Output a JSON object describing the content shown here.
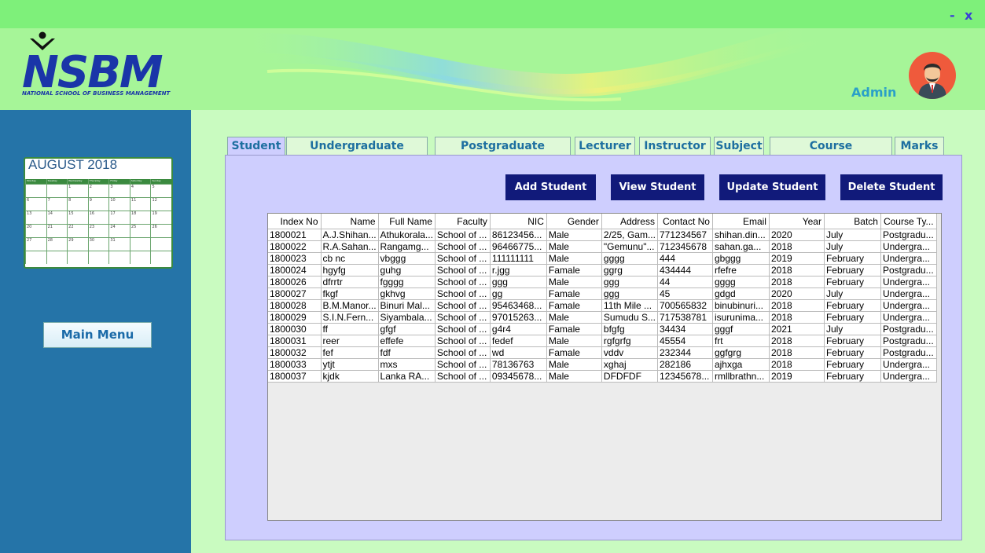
{
  "window": {
    "minimize": "-",
    "close": "x"
  },
  "logo": {
    "text": "NSBM",
    "subtitle": "NATIONAL SCHOOL OF BUSINESS MANAGEMENT"
  },
  "header": {
    "user": "Admin"
  },
  "calendar": {
    "title": "AUGUST 2018",
    "days": [
      "Monday",
      "Tuesday",
      "Wednesday",
      "Thursday",
      "Friday",
      "Saturday",
      "Sunday"
    ],
    "rows": [
      [
        "",
        "",
        "1",
        "2",
        "3",
        "4",
        "5"
      ],
      [
        "6",
        "7",
        "8",
        "9",
        "10",
        "11",
        "12"
      ],
      [
        "13",
        "14",
        "15",
        "16",
        "17",
        "18",
        "19"
      ],
      [
        "20",
        "21",
        "22",
        "23",
        "24",
        "25",
        "26"
      ],
      [
        "27",
        "28",
        "29",
        "30",
        "31",
        "",
        ""
      ],
      [
        "",
        "",
        "",
        "",
        "",
        "",
        ""
      ]
    ]
  },
  "sidebar": {
    "main_menu": "Main Menu"
  },
  "tabs": [
    "Student",
    "Undergraduate Student",
    "Postgraduate Student",
    "Lecturer",
    "Instructor",
    "Subject",
    "Course Registration",
    "Marks"
  ],
  "buttons": {
    "add": "Add Student",
    "view": "View Student",
    "update": "Update Student",
    "delete": "Delete Student"
  },
  "table": {
    "columns": [
      "Index No",
      "Name",
      "Full Name",
      "Faculty",
      "NIC",
      "Gender",
      "Address",
      "Contact No",
      "Email",
      "Year",
      "Batch",
      "Course Ty..."
    ],
    "rows": [
      [
        "1800021",
        "A.J.Shihan...",
        "Athukorala...",
        "School of ...",
        "86123456...",
        "Male",
        "2/25, Gam...",
        "771234567",
        "shihan.din...",
        "2020",
        "July",
        "Postgradu..."
      ],
      [
        "1800022",
        "R.A.Sahan...",
        "Rangamg...",
        "School of ...",
        "96466775...",
        "Male",
        "\"Gemunu\"...",
        "712345678",
        "sahan.ga...",
        "2018",
        "July",
        "Undergra..."
      ],
      [
        "1800023",
        "cb nc",
        "vbggg",
        "School of ...",
        "111111111",
        "Male",
        "gggg",
        "444",
        "gbggg",
        "2019",
        "February",
        "Undergra..."
      ],
      [
        "1800024",
        "hgyfg",
        "guhg",
        "School of ...",
        "r.jgg",
        "Famale",
        "ggrg",
        "434444",
        "rfefre",
        "2018",
        "February",
        "Postgradu..."
      ],
      [
        "1800026",
        "dfrrtr",
        "fgggg",
        "School of ...",
        "ggg",
        "Male",
        "ggg",
        "44",
        "gggg",
        "2018",
        "February",
        "Undergra..."
      ],
      [
        "1800027",
        "fkgf",
        "gkhvg",
        "School of ...",
        "gg",
        "Famale",
        "ggg",
        "45",
        "gdgd",
        "2020",
        "July",
        "Undergra..."
      ],
      [
        "1800028",
        "B.M.Manor...",
        "Binuri Mal...",
        "School of ...",
        "95463468...",
        "Famale",
        "11th Mile ...",
        "700565832",
        "binubinuri...",
        "2018",
        "February",
        "Undergra..."
      ],
      [
        "1800029",
        "S.I.N.Fern...",
        "Siyambala...",
        "School of ...",
        "97015263...",
        "Male",
        "Sumudu S...",
        "717538781",
        "isurunima...",
        "2018",
        "February",
        "Undergra..."
      ],
      [
        "1800030",
        "ff",
        "gfgf",
        "School of ...",
        "g4r4",
        "Famale",
        "bfgfg",
        "34434",
        "gggf",
        "2021",
        "July",
        "Postgradu..."
      ],
      [
        "1800031",
        "reer",
        "effefe",
        "School of ...",
        "fedef",
        "Male",
        "rgfgrfg",
        "45554",
        "frt",
        "2018",
        "February",
        "Postgradu..."
      ],
      [
        "1800032",
        "fef",
        "fdf",
        "School of ...",
        "wd",
        "Famale",
        "vddv",
        "232344",
        "ggfgrg",
        "2018",
        "February",
        "Postgradu..."
      ],
      [
        "1800033",
        "ytjt",
        "mxs",
        "School of ...",
        "78136763",
        "Male",
        "xghaj",
        "282186",
        "ajhxga",
        "2018",
        "February",
        "Undergra..."
      ],
      [
        "1800037",
        "kjdk",
        "Lanka RA...",
        "School of ...",
        "09345678...",
        "Male",
        "DFDFDF",
        "12345678...",
        "rmllbrathn...",
        "2019",
        "February",
        "Undergra..."
      ]
    ]
  }
}
